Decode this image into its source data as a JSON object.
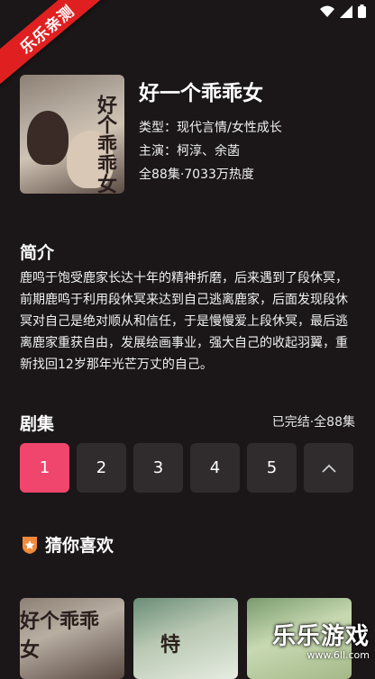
{
  "badge": "乐乐亲测",
  "drama": {
    "title": "好一个乖乖女",
    "type_line": "类型：现代言情/女性成长",
    "cast_line": "主演：柯淳、余菡",
    "stats_line": "全88集·7033万热度",
    "poster_text": "好个乖乖女"
  },
  "synopsis": {
    "heading": "简介",
    "text": "鹿鸣于饱受鹿家长达十年的精神折磨，后来遇到了段休冥，前期鹿鸣于利用段休冥来达到自己逃离鹿家，后面发现段休冥对自己是绝对顺从和信任，于是慢慢爱上段休冥，最后逃离鹿家重获自由，发展绘画事业，强大自己的收起羽翼，重新找回12岁那年光芒万丈的自己。"
  },
  "episodes": {
    "heading": "剧集",
    "status": "已完结·全88集",
    "items": [
      "1",
      "2",
      "3",
      "4",
      "5"
    ],
    "active": "1",
    "collapse_icon": "chevron-up-icon"
  },
  "recommend": {
    "heading": "猜你喜欢",
    "icon": "badge-star-icon",
    "thumb_texts": [
      "好个乖乖女",
      "特",
      ""
    ]
  },
  "watermark": {
    "brand": "乐乐游戏",
    "url": "www.6ll.com"
  },
  "colors": {
    "background": "#1b1718",
    "accent": "#f0456d",
    "badge": "#e02020"
  }
}
